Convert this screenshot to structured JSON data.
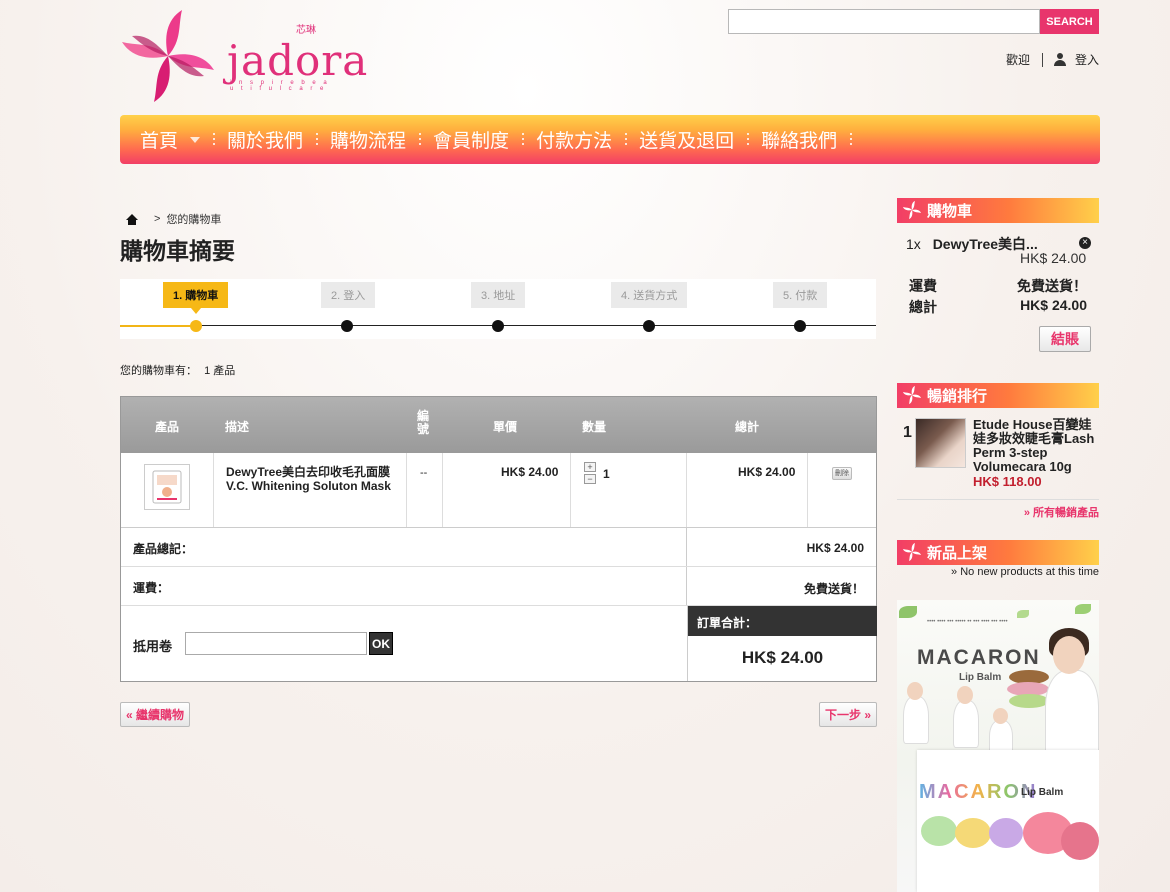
{
  "header": {
    "logo_text": "jadora",
    "logo_cn": "芯琳",
    "logo_tagline": "i n s p i r e   b e a u t i f u l   c a r e",
    "search_placeholder": "",
    "search_button": "SEARCH",
    "welcome": "歡迎",
    "login": "登入"
  },
  "nav": {
    "items": [
      "首頁",
      "關於我們",
      "購物流程",
      "會員制度",
      "付款方法",
      "送貨及退回",
      "聯絡我們"
    ]
  },
  "breadcrumb": {
    "separator": ">",
    "current": "您的購物車"
  },
  "page_title": "購物車摘要",
  "steps": [
    "1. 購物車",
    "2. 登入",
    "3. 地址",
    "4. 送貨方式",
    "5. 付款"
  ],
  "cart_count": {
    "label": "您的購物車有：",
    "value": "1 產品"
  },
  "table": {
    "headers": {
      "product": "產品",
      "description": "描述",
      "ref": "編號",
      "unit_price": "單價",
      "qty": "數量",
      "total": "總計"
    },
    "rows": [
      {
        "description": "DewyTree美白去印收毛孔面膜V.C. Whitening Soluton Mask",
        "ref": "--",
        "unit_price": "HK$ 24.00",
        "qty": "1",
        "total": "HK$ 24.00",
        "delete": "刪除"
      }
    ],
    "subtotal_label": "產品總記：",
    "subtotal_value": "HK$ 24.00",
    "shipping_label": "運費：",
    "shipping_value": "免費送貨！",
    "voucher_label": "抵用卷",
    "voucher_ok": "OK",
    "order_total_label": "訂單合計：",
    "order_total_value": "HK$ 24.00"
  },
  "buttons": {
    "continue": "« 繼續購物",
    "next": "下一步 »"
  },
  "sidebar": {
    "cart": {
      "title": "購物車",
      "item_qty": "1x",
      "item_name": "DewyTree美白...",
      "item_price": "HK$ 24.00",
      "shipping_label": "運費",
      "shipping_value": "免費送貨！",
      "total_label": "總計",
      "total_value": "HK$ 24.00",
      "checkout": "結賬"
    },
    "bestsellers": {
      "title": "暢銷排行",
      "rank": "1",
      "name": "Etude House百變娃娃多妝效睫毛膏Lash Perm 3-step Volumecara 10g",
      "price": "HK$ 118.00",
      "all_link": "» 所有暢銷產品"
    },
    "new_products": {
      "title": "新品上架",
      "note": "» No new products at this time"
    },
    "ad": {
      "title": "MACARON",
      "subtitle": "Lip Balm",
      "title2": "MACARON",
      "subtitle2": "Lip Balm"
    }
  },
  "colors": {
    "accent": "#e8356c",
    "step_active": "#f6b816",
    "nav_top": "#ffd14a",
    "nav_bottom": "#f23e66"
  }
}
